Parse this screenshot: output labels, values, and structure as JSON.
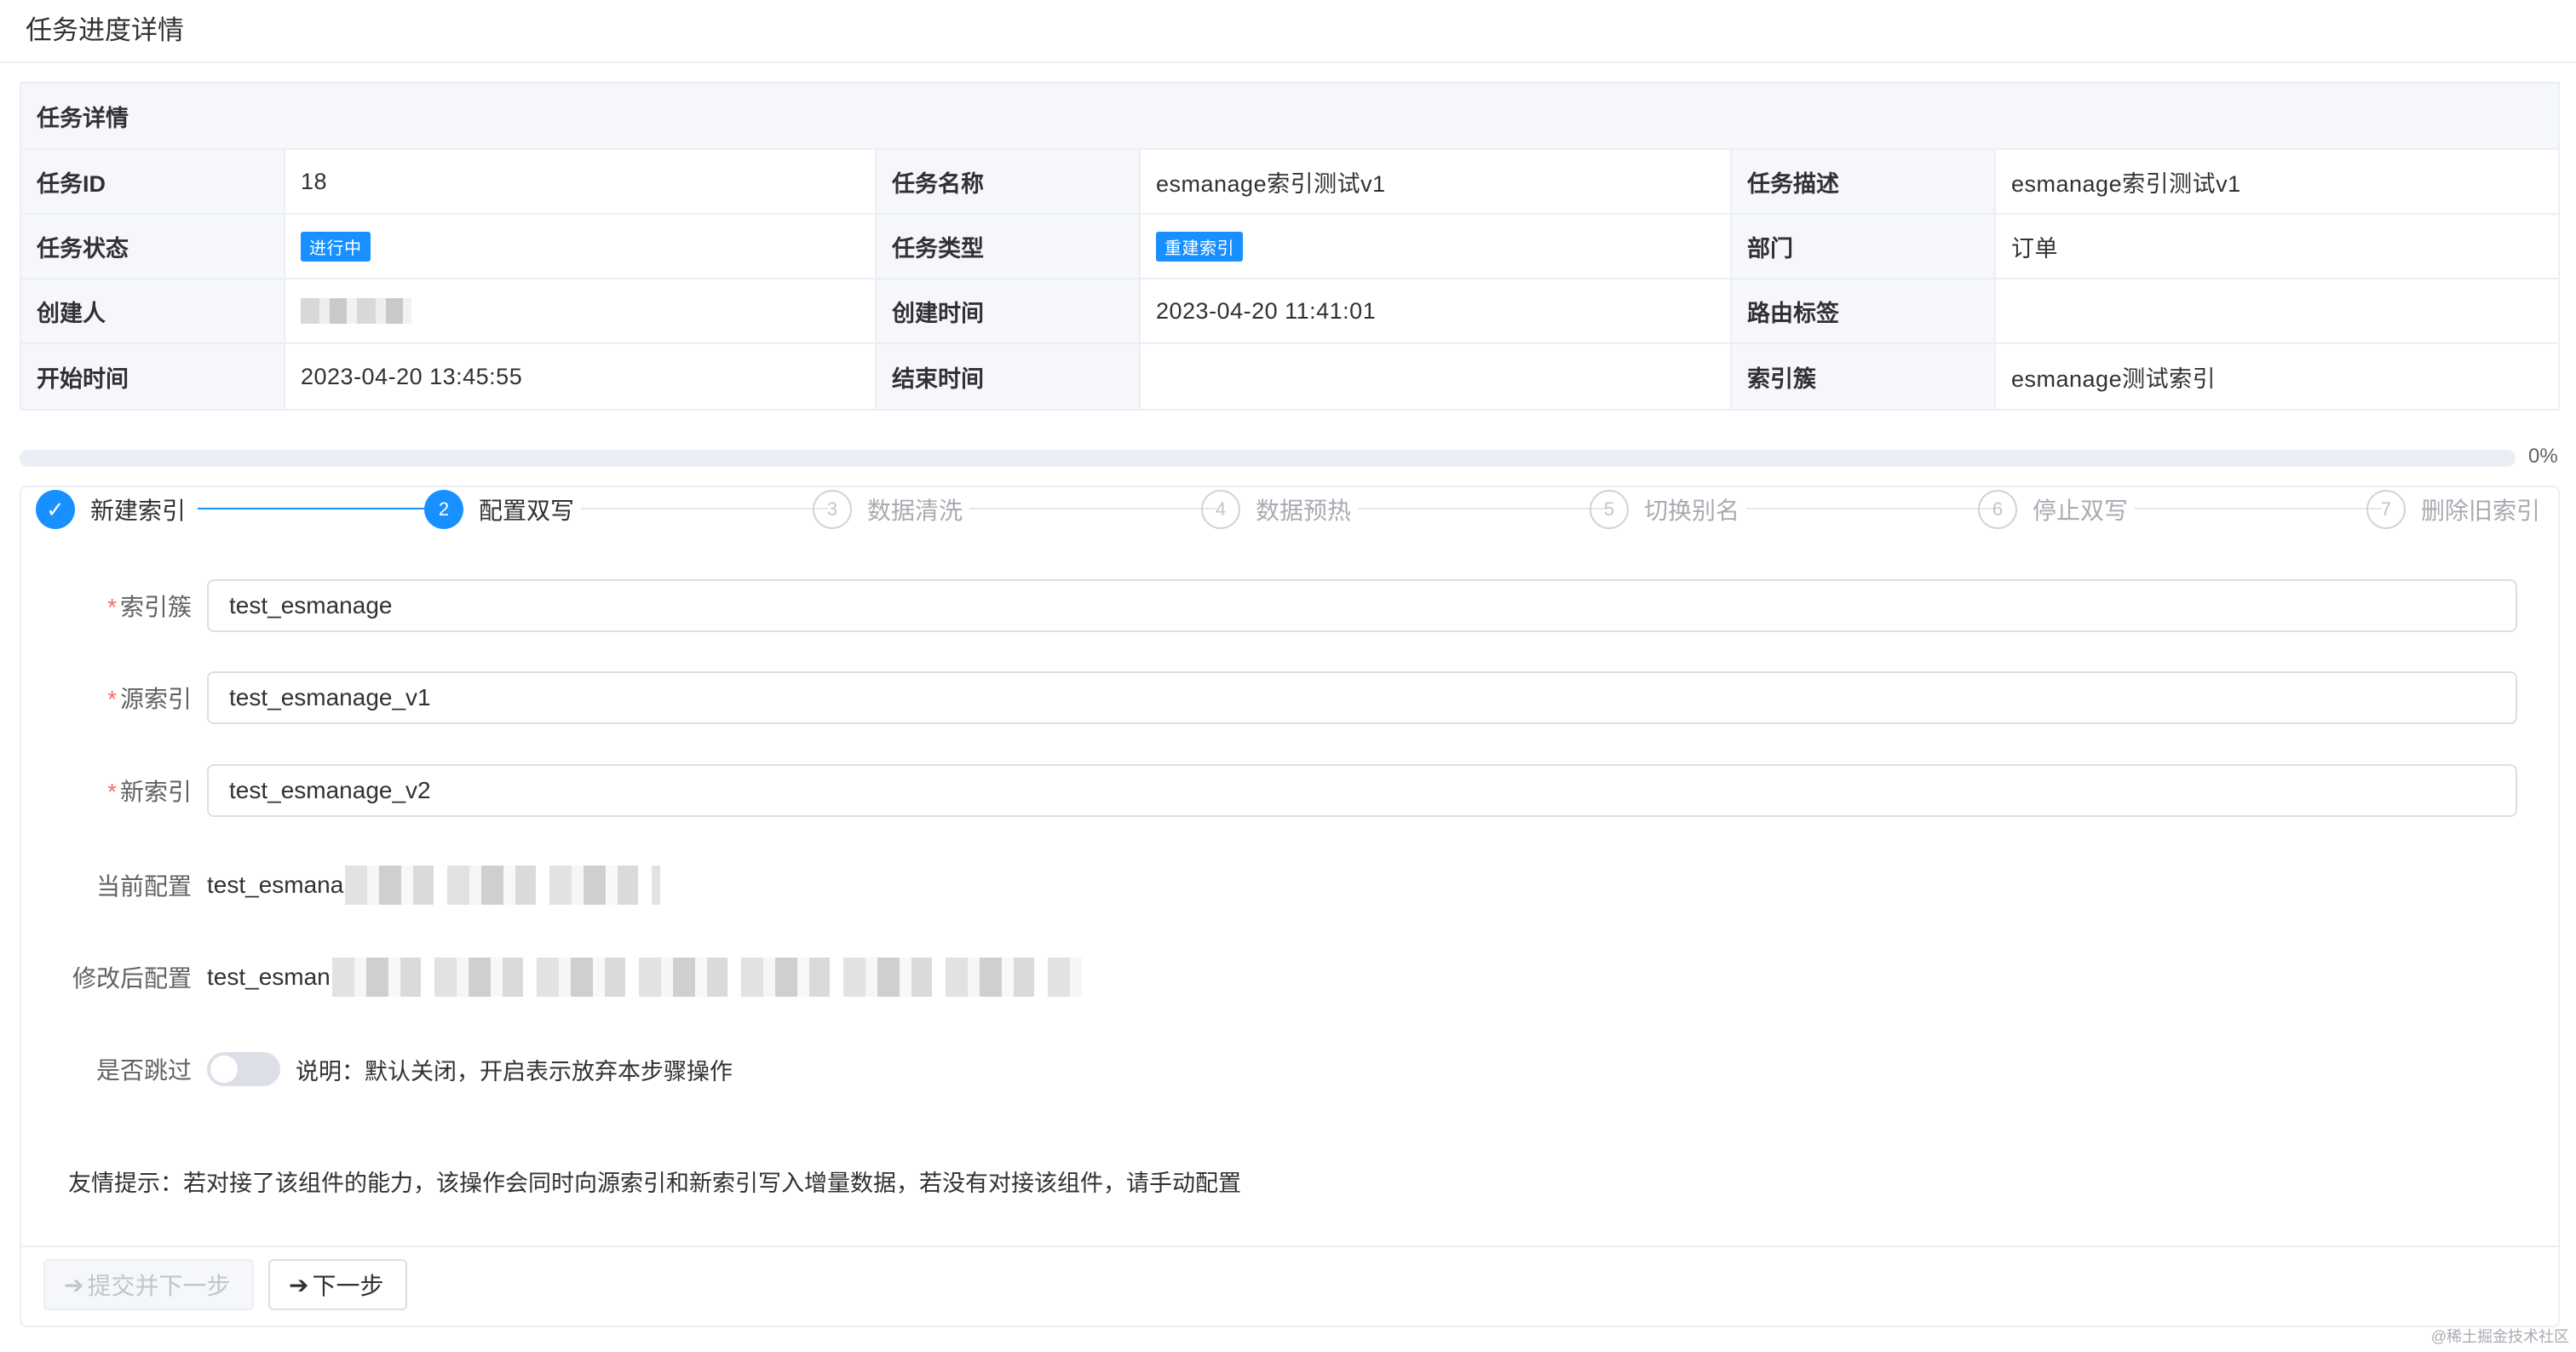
{
  "page": {
    "title": "任务进度详情"
  },
  "detail": {
    "header": "任务详情",
    "rows": [
      {
        "l1": "任务ID",
        "v1": "18",
        "l2": "任务名称",
        "v2": "esmanage索引测试v1",
        "l3": "任务描述",
        "v3": "esmanage索引测试v1"
      },
      {
        "l1": "任务状态",
        "v1": "进行中",
        "l2": "任务类型",
        "v2": "重建索引",
        "l3": "部门",
        "v3": "订单"
      },
      {
        "l1": "创建人",
        "v1": "",
        "l2": "创建时间",
        "v2": "2023-04-20 11:41:01",
        "l3": "路由标签",
        "v3": ""
      },
      {
        "l1": "开始时间",
        "v1": "2023-04-20 13:45:55",
        "l2": "结束时间",
        "v2": "",
        "l3": "索引簇",
        "v3": "esmanage测试索引"
      }
    ]
  },
  "progress": {
    "value": 0,
    "text": "0%"
  },
  "steps": [
    {
      "num": "✓",
      "label": "新建索引",
      "state": "done"
    },
    {
      "num": "2",
      "label": "配置双写",
      "state": "active"
    },
    {
      "num": "3",
      "label": "数据清洗",
      "state": "wait"
    },
    {
      "num": "4",
      "label": "数据预热",
      "state": "wait"
    },
    {
      "num": "5",
      "label": "切换别名",
      "state": "wait"
    },
    {
      "num": "6",
      "label": "停止双写",
      "state": "wait"
    },
    {
      "num": "7",
      "label": "删除旧索引",
      "state": "wait"
    }
  ],
  "form": {
    "cluster": {
      "label": "索引簇",
      "value": "test_esmanage"
    },
    "source": {
      "label": "源索引",
      "value": "test_esmanage_v1"
    },
    "target": {
      "label": "新索引",
      "value": "test_esmanage_v2"
    },
    "current_config": {
      "label": "当前配置",
      "value": "test_esmana"
    },
    "modified_config": {
      "label": "修改后配置",
      "value": "test_esman"
    },
    "skip": {
      "label": "是否跳过",
      "desc": "说明：默认关闭，开启表示放弃本步骤操作"
    }
  },
  "tip": "友情提示：若对接了该组件的能力，该操作会同时向源索引和新索引写入增量数据，若没有对接该组件，请手动配置",
  "buttons": {
    "submit_next": "提交并下一步",
    "next": "下一步"
  },
  "footer_mark": "@稀土掘金技术社区",
  "colors": {
    "primary": "#1890ff",
    "required": "#f56c6c",
    "border": "#ebeef5"
  }
}
